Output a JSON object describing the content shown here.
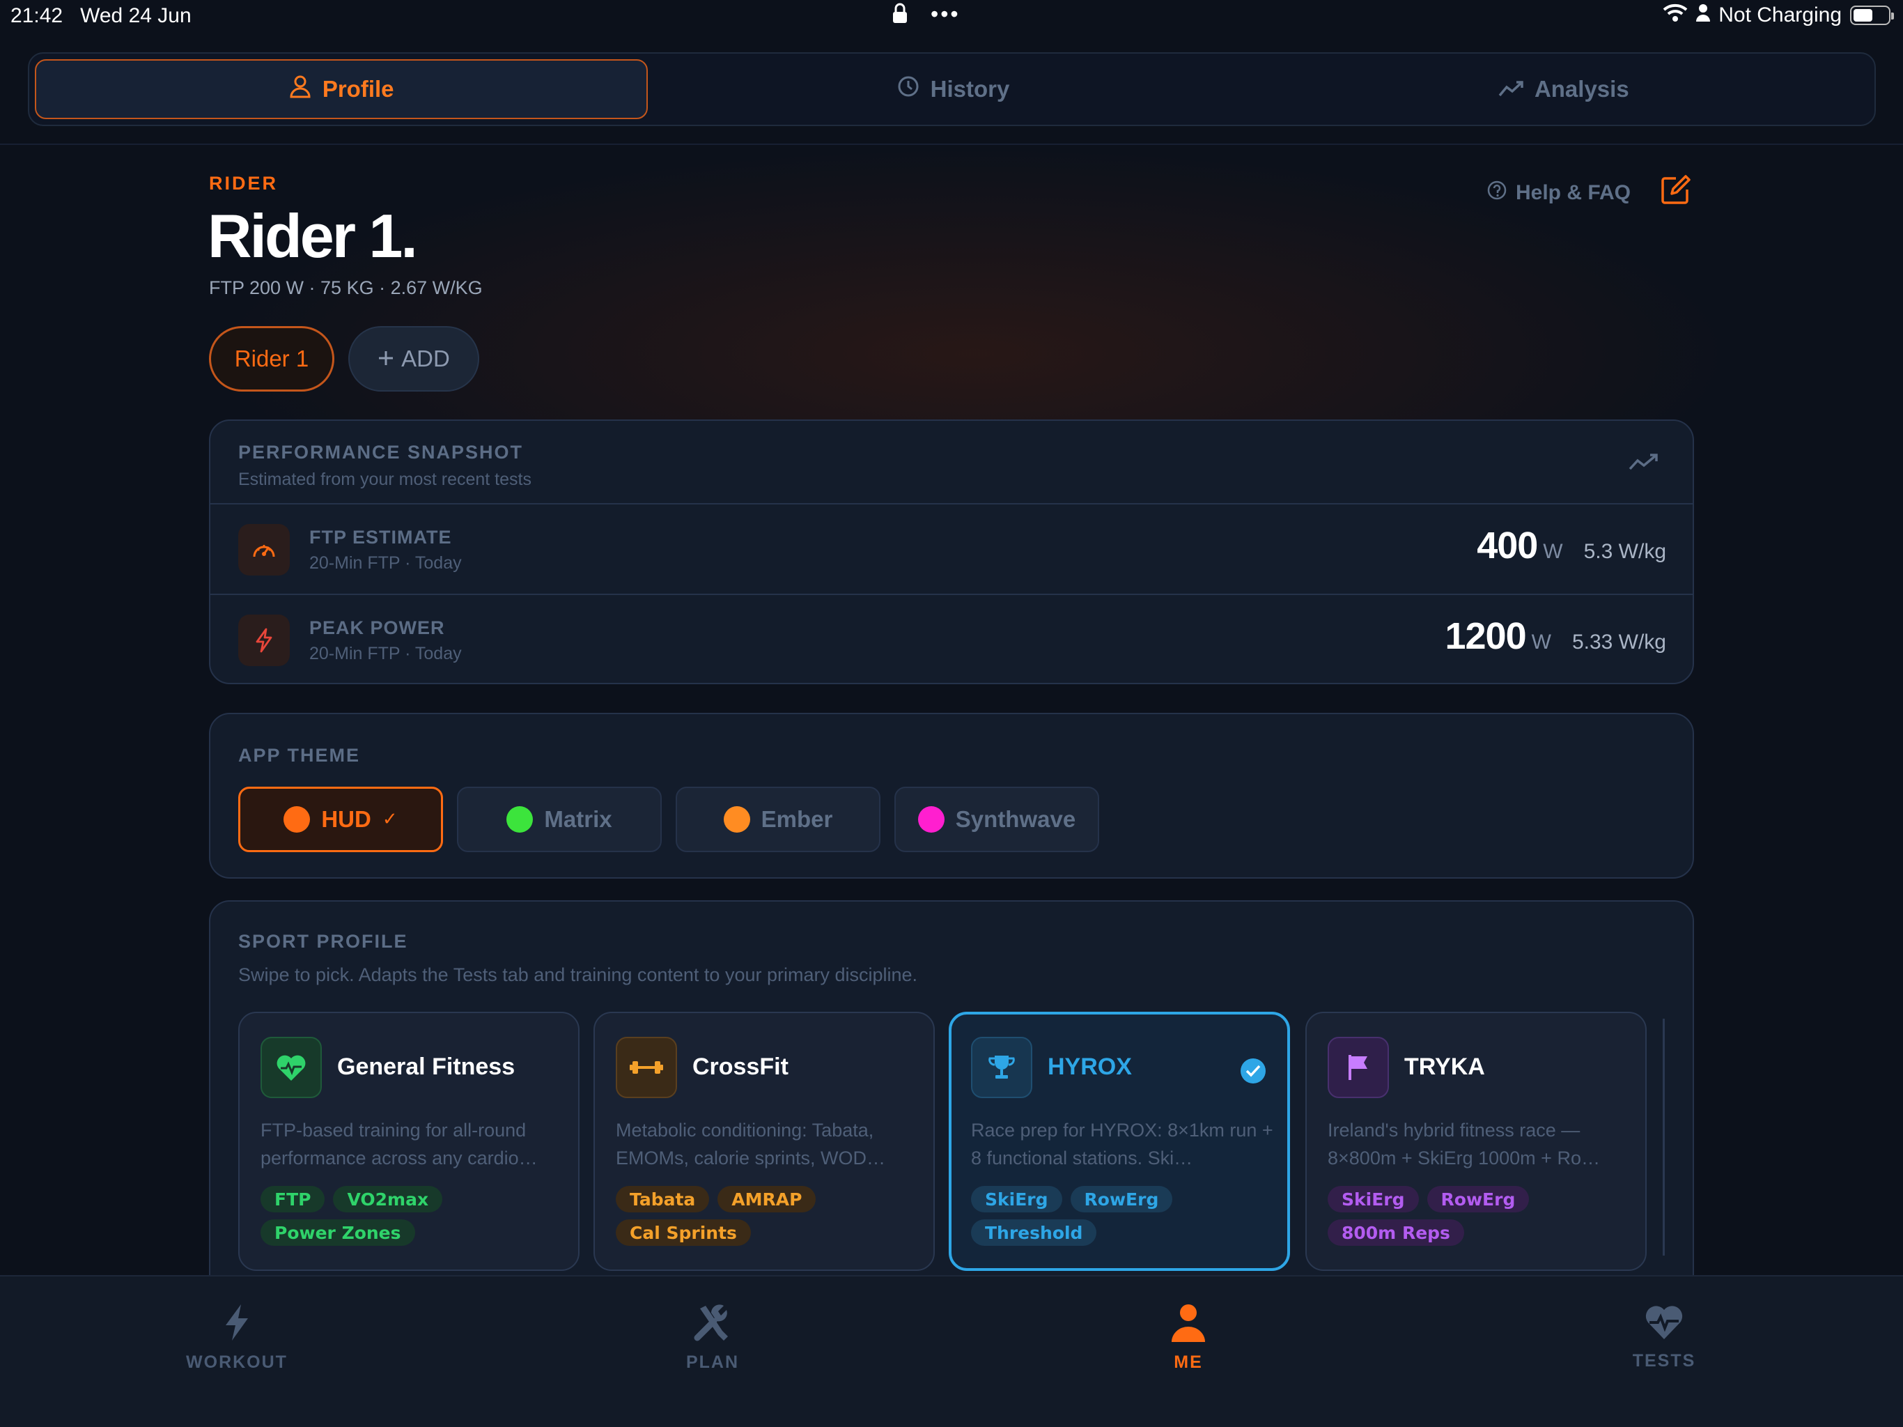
{
  "status_bar": {
    "time": "21:42",
    "date": "Wed 24 Jun",
    "dots": "•••",
    "charging": "Not Charging"
  },
  "top_tabs": [
    {
      "label": "Profile",
      "icon": "person-icon",
      "active": true
    },
    {
      "label": "History",
      "icon": "clock-icon",
      "active": false
    },
    {
      "label": "Analysis",
      "icon": "trend-icon",
      "active": false
    }
  ],
  "profile": {
    "caption": "RIDER",
    "name": "Rider 1.",
    "stats": "FTP 200 W · 75 KG · 2.67 W/KG",
    "help_label": "Help & FAQ",
    "rider_chip": "Rider 1",
    "add_label": "ADD"
  },
  "performance": {
    "title": "PERFORMANCE SNAPSHOT",
    "subtitle": "Estimated from your most recent tests",
    "rows": [
      {
        "label": "FTP ESTIMATE",
        "meta": "20-Min FTP · Today",
        "value": "400",
        "unit": "W",
        "wkg": "5.3 W/kg",
        "icon": "gauge-icon"
      },
      {
        "label": "PEAK POWER",
        "meta": "20-Min FTP · Today",
        "value": "1200",
        "unit": "W",
        "wkg": "5.33 W/kg",
        "icon": "bolt-icon"
      }
    ]
  },
  "theme": {
    "title": "APP THEME",
    "options": [
      {
        "label": "HUD",
        "color": "#ff6b13",
        "active": true,
        "check": "✓"
      },
      {
        "label": "Matrix",
        "color": "#3ce43c",
        "active": false
      },
      {
        "label": "Ember",
        "color": "#ff8c22",
        "active": false
      },
      {
        "label": "Synthwave",
        "color": "#ff1fcf",
        "active": false
      }
    ]
  },
  "sport_profile": {
    "title": "SPORT PROFILE",
    "subtitle": "Swipe to pick. Adapts the Tests tab and training content to your primary discipline.",
    "cards": [
      {
        "name": "General Fitness",
        "desc": "FTP-based training for all-round performance across any cardio…",
        "tags": [
          "FTP",
          "VO2max",
          "Power Zones"
        ],
        "accent": "#2fd36a",
        "active": false,
        "icon": "heart-pulse-icon"
      },
      {
        "name": "CrossFit",
        "desc": "Metabolic conditioning: Tabata, EMOMs, calorie sprints, WOD…",
        "tags": [
          "Tabata",
          "AMRAP",
          "Cal Sprints"
        ],
        "accent": "#f4a12a",
        "active": false,
        "icon": "dumbbell-icon"
      },
      {
        "name": "HYROX",
        "desc": "Race prep for HYROX: 8×1km run + 8 functional stations. Ski…",
        "tags": [
          "SkiErg",
          "RowErg",
          "Threshold"
        ],
        "accent": "#2ea6e6",
        "active": true,
        "icon": "trophy-icon"
      },
      {
        "name": "TRYKA",
        "desc": "Ireland's hybrid fitness race — 8×800m + SkiErg 1000m + Ro…",
        "tags": [
          "SkiErg",
          "RowErg",
          "800m Reps"
        ],
        "accent": "#b35cf0",
        "active": false,
        "icon": "flag-icon"
      }
    ]
  },
  "bottom_nav": [
    {
      "label": "WORKOUT",
      "icon": "bolt-icon",
      "active": false
    },
    {
      "label": "PLAN",
      "icon": "tools-icon",
      "active": false
    },
    {
      "label": "ME",
      "icon": "person-icon",
      "active": true
    },
    {
      "label": "TESTS",
      "icon": "heart-pulse-icon",
      "active": false
    }
  ]
}
